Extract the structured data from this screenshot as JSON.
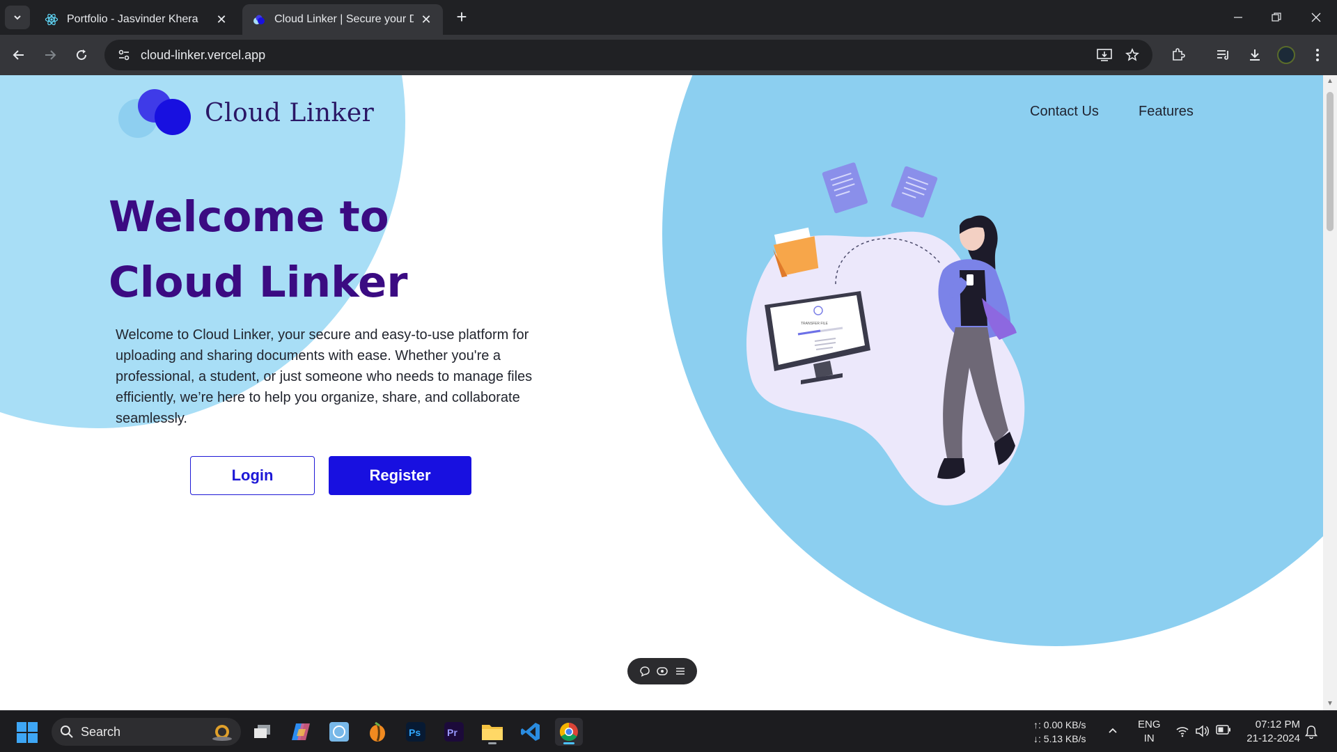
{
  "browser": {
    "tabs": [
      {
        "title": "Portfolio - Jasvinder Khera",
        "icon": "react-icon",
        "active": false
      },
      {
        "title": "Cloud Linker | Secure your Docu",
        "icon": "cloud-linker-icon",
        "active": true
      }
    ],
    "url": "cloud-linker.vercel.app"
  },
  "page": {
    "logo_text": "Cloud Linker",
    "nav": {
      "contact": "Contact Us",
      "features": "Features"
    },
    "hero": {
      "title_line1": "Welcome to",
      "title_line2": "Cloud Linker",
      "description": "Welcome to Cloud Linker, your secure and easy-to-use platform for uploading and sharing documents with ease. Whether you're a professional, a student, or just someone who needs to manage files efficiently, we’re here to help you organize, share, and collaborate seamlessly."
    },
    "buttons": {
      "login": "Login",
      "register": "Register"
    },
    "illustration_caption": "TRANSFER FILE",
    "colors": {
      "accent": "#1810e0",
      "title": "#3b0b82",
      "blob_left": "#a8def6",
      "blob_right": "#8ccff0"
    }
  },
  "taskbar": {
    "search_placeholder": "Search",
    "apps": [
      "task-view",
      "copilot",
      "photos",
      "fl-studio",
      "photoshop",
      "premiere-pro",
      "file-explorer",
      "vs-code",
      "chrome"
    ],
    "net_up": "↑: 0.00 KB/s",
    "net_down": "↓: 5.13 KB/s",
    "lang_line1": "ENG",
    "lang_line2": "IN",
    "time": "07:12 PM",
    "date": "21-12-2024"
  }
}
